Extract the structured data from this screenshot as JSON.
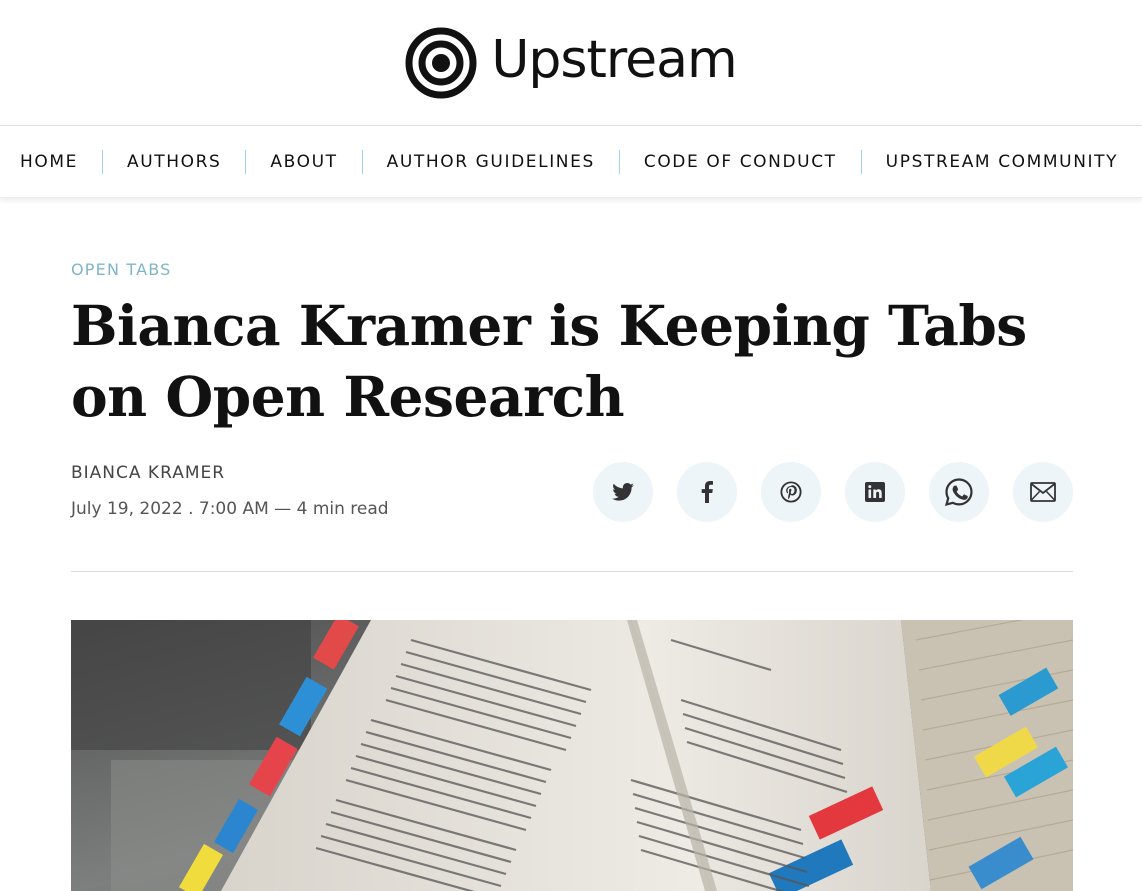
{
  "site": {
    "name": "Upstream"
  },
  "nav": {
    "items": [
      {
        "label": "HOME"
      },
      {
        "label": "AUTHORS"
      },
      {
        "label": "ABOUT"
      },
      {
        "label": "AUTHOR GUIDELINES"
      },
      {
        "label": "CODE OF CONDUCT"
      },
      {
        "label": "UPSTREAM COMMUNITY"
      }
    ]
  },
  "article": {
    "tag": "OPEN TABS",
    "title": "Bianca Kramer is Keeping Tabs on Open Research",
    "author": "BIANCA KRAMER",
    "date": "July 19, 2022 . 7:00 AM",
    "read_time": "4 min read"
  },
  "share": {
    "icons": [
      "twitter-icon",
      "facebook-icon",
      "pinterest-icon",
      "linkedin-icon",
      "whatsapp-icon",
      "email-icon"
    ]
  },
  "colors": {
    "accent": "#7fb5c8",
    "separator": "#9fd3e6",
    "share_bg": "#edf5f8",
    "text": "#111111"
  }
}
